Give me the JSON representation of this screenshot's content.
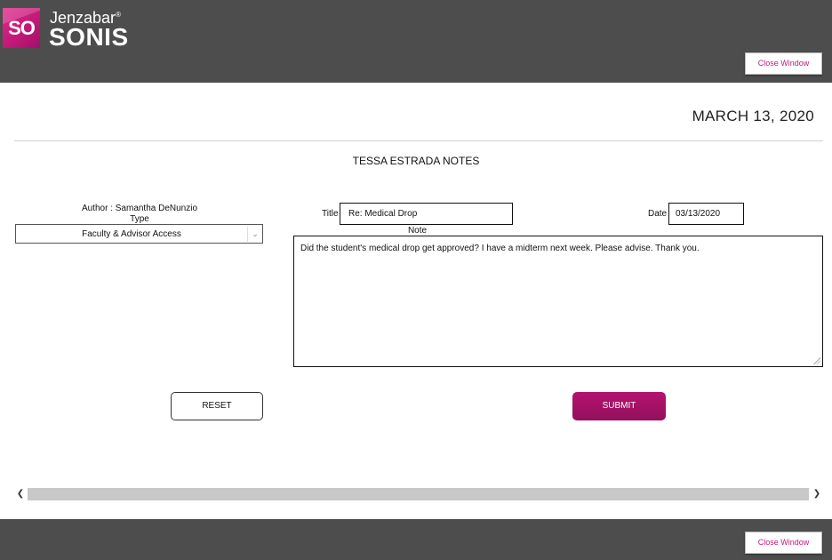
{
  "header": {
    "logo_text": "SO",
    "brand_line1": "Jenzabar",
    "brand_line2": "SONIS",
    "close_label": "Close Window"
  },
  "page": {
    "date_heading": "MARCH 13, 2020",
    "notes_title": "TESSA ESTRADA NOTES"
  },
  "form": {
    "author": "Author : Samantha DeNunzio",
    "type_label": "Type",
    "type_value": "Faculty & Advisor Access",
    "title_label": "Title",
    "title_value": "Re: Medical Drop",
    "date_label": "Date",
    "date_value": "03/13/2020",
    "note_label": "Note",
    "note_value": "Did the student's medical drop get approved? I have a midterm next week. Please advise. Thank you.",
    "reset_label": "RESET",
    "submit_label": "SUBMIT"
  },
  "footer": {
    "close_label": "Close Window"
  },
  "colors": {
    "bar": "#4d4d4d",
    "accent": "#c2187a",
    "submit": "#a3115f"
  }
}
